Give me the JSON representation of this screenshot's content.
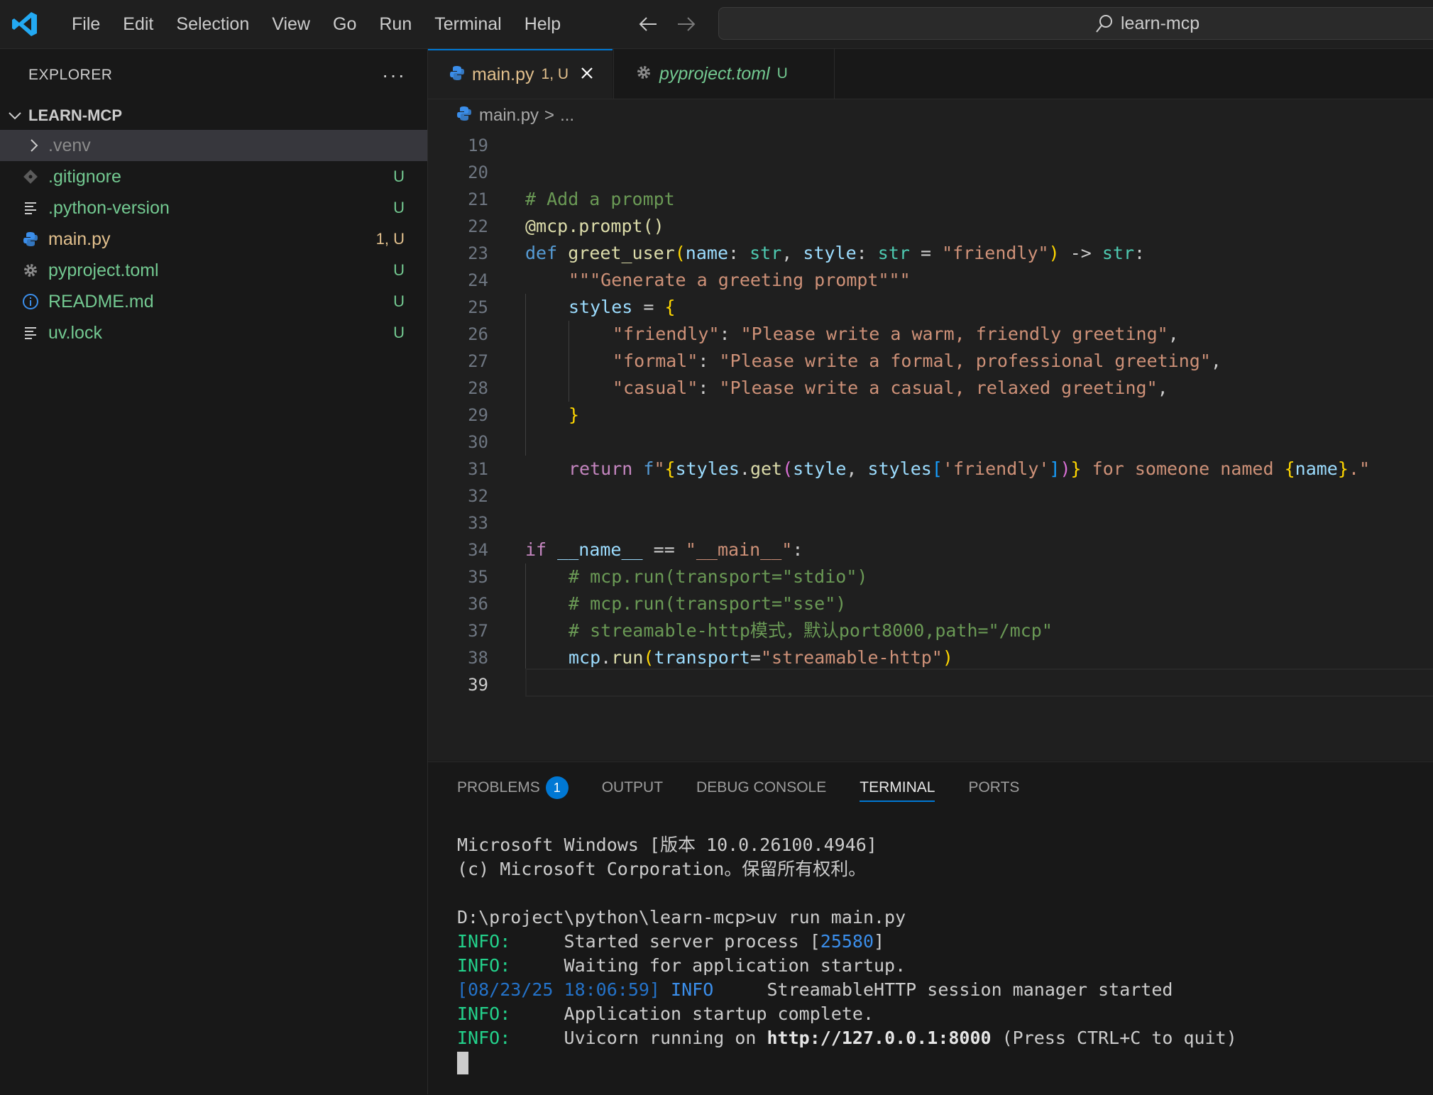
{
  "menu": [
    "File",
    "Edit",
    "Selection",
    "View",
    "Go",
    "Run",
    "Terminal",
    "Help"
  ],
  "search": {
    "text": "learn-mcp"
  },
  "explorer": {
    "title": "EXPLORER",
    "more": "···",
    "folder": "LEARN-MCP",
    "items": [
      {
        "label": ".venv",
        "badge": ""
      },
      {
        "label": ".gitignore",
        "badge": "U"
      },
      {
        "label": ".python-version",
        "badge": "U"
      },
      {
        "label": "main.py",
        "badge": "1, U"
      },
      {
        "label": "pyproject.toml",
        "badge": "U"
      },
      {
        "label": "README.md",
        "badge": "U"
      },
      {
        "label": "uv.lock",
        "badge": "U"
      }
    ]
  },
  "tabs": [
    {
      "label": "main.py",
      "badge": "1, U"
    },
    {
      "label": "pyproject.toml",
      "badge": "U"
    }
  ],
  "breadcrumb": {
    "file": "main.py",
    "sep": ">",
    "rest": "..."
  },
  "code": {
    "line_numbers": [
      "19",
      "20",
      "21",
      "22",
      "23",
      "24",
      "25",
      "26",
      "27",
      "28",
      "29",
      "30",
      "31",
      "32",
      "33",
      "34",
      "35",
      "36",
      "37",
      "38",
      "39"
    ],
    "comment_21": "# Add a prompt",
    "decorator_22": "@mcp.prompt()",
    "docstring_24": "\"\"\"Generate a greeting prompt\"\"\"",
    "comment_35": "# mcp.run(transport=\"stdio\")",
    "comment_36": "# mcp.run(transport=\"sse\")",
    "comment_37": "# streamable-http模式，默认port8000,path=\"/mcp\""
  },
  "panel": {
    "tabs": [
      "PROBLEMS",
      "OUTPUT",
      "DEBUG CONSOLE",
      "TERMINAL",
      "PORTS"
    ],
    "problems_count": "1",
    "terminal": {
      "line1": "Microsoft Windows [版本 10.0.26100.4946]",
      "line2": "(c) Microsoft Corporation。保留所有权利。",
      "prompt": "D:\\project\\python\\learn-mcp>uv run main.py",
      "info": "INFO:",
      "msg1a": "     Started server process [",
      "pid": "25580",
      "msg1b": "]",
      "msg2": "     Waiting for application startup.",
      "ts": "[08/23/25 18:06:59]",
      "ts_info": " INFO",
      "msg3": "     StreamableHTTP session manager started",
      "msg4": "     Application startup complete.",
      "msg5a": "     Uvicorn running on ",
      "url": "http://127.0.0.1:8000",
      "msg5b": " (Press CTRL+C to quit)"
    }
  }
}
